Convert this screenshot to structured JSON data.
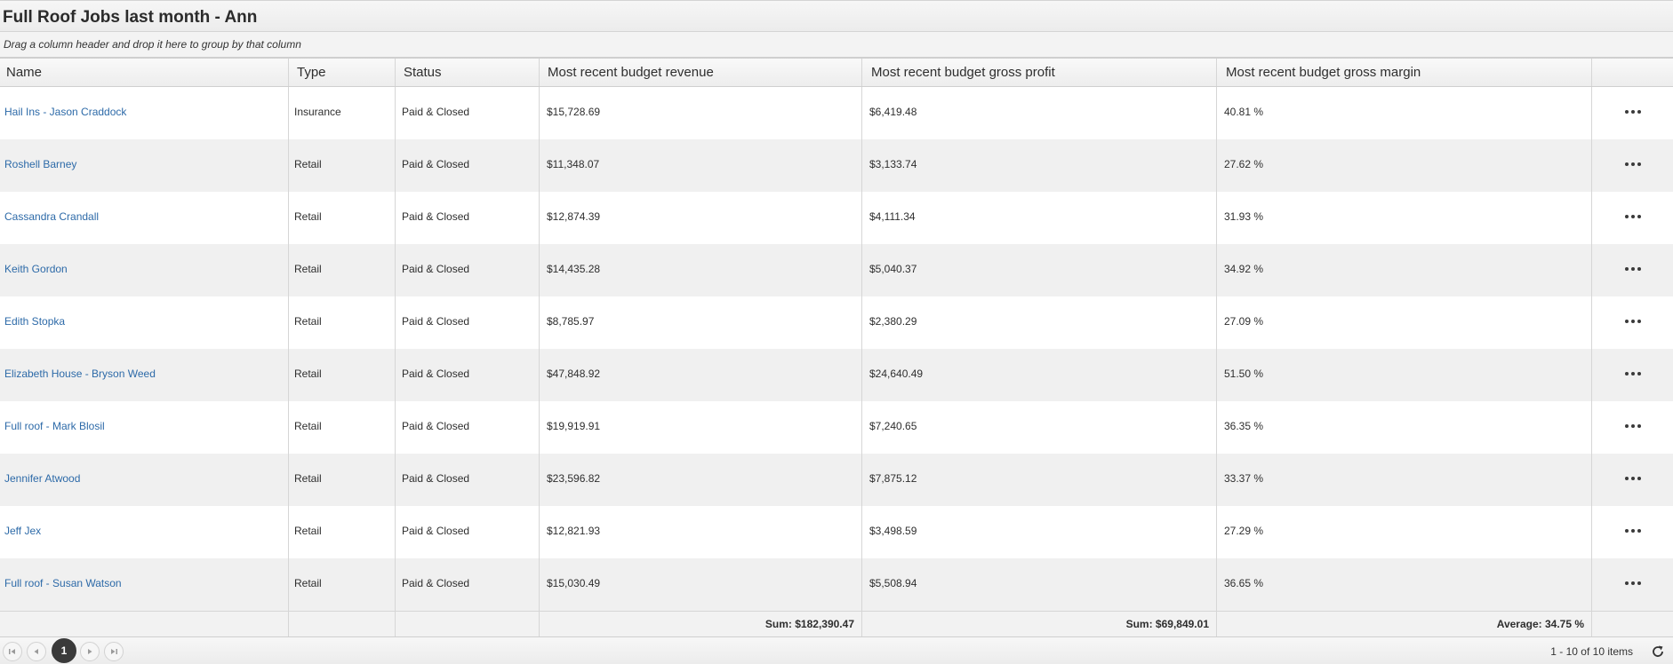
{
  "title": "Full Roof Jobs last month - Ann",
  "group_hint": "Drag a column header and drop it here to group by that column",
  "columns": [
    "Name",
    "Type",
    "Status",
    "Most recent budget revenue",
    "Most recent budget gross profit",
    "Most recent budget gross margin",
    ""
  ],
  "rows": [
    {
      "name": "Hail Ins - Jason Craddock",
      "type": "Insurance",
      "status": "Paid & Closed",
      "revenue": "$15,728.69",
      "profit": "$6,419.48",
      "margin": "40.81 %"
    },
    {
      "name": "Roshell Barney",
      "type": "Retail",
      "status": "Paid & Closed",
      "revenue": "$11,348.07",
      "profit": "$3,133.74",
      "margin": "27.62 %"
    },
    {
      "name": "Cassandra Crandall",
      "type": "Retail",
      "status": "Paid & Closed",
      "revenue": "$12,874.39",
      "profit": "$4,111.34",
      "margin": "31.93 %"
    },
    {
      "name": "Keith Gordon",
      "type": "Retail",
      "status": "Paid & Closed",
      "revenue": "$14,435.28",
      "profit": "$5,040.37",
      "margin": "34.92 %"
    },
    {
      "name": "Edith Stopka",
      "type": "Retail",
      "status": "Paid & Closed",
      "revenue": "$8,785.97",
      "profit": "$2,380.29",
      "margin": "27.09 %"
    },
    {
      "name": "Elizabeth House - Bryson Weed",
      "type": "Retail",
      "status": "Paid & Closed",
      "revenue": "$47,848.92",
      "profit": "$24,640.49",
      "margin": "51.50 %"
    },
    {
      "name": "Full roof - Mark Blosil",
      "type": "Retail",
      "status": "Paid & Closed",
      "revenue": "$19,919.91",
      "profit": "$7,240.65",
      "margin": "36.35 %"
    },
    {
      "name": "Jennifer Atwood",
      "type": "Retail",
      "status": "Paid & Closed",
      "revenue": "$23,596.82",
      "profit": "$7,875.12",
      "margin": "33.37 %"
    },
    {
      "name": "Jeff Jex",
      "type": "Retail",
      "status": "Paid & Closed",
      "revenue": "$12,821.93",
      "profit": "$3,498.59",
      "margin": "27.29 %"
    },
    {
      "name": "Full roof - Susan Watson",
      "type": "Retail",
      "status": "Paid & Closed",
      "revenue": "$15,030.49",
      "profit": "$5,508.94",
      "margin": "36.65 %"
    }
  ],
  "footer": {
    "revenue_sum": "Sum: $182,390.47",
    "profit_sum": "Sum: $69,849.01",
    "margin_avg": "Average: 34.75 %"
  },
  "pager": {
    "first_icon": "first-page-icon",
    "prev_icon": "prev-page-icon",
    "current_page": "1",
    "next_icon": "next-page-icon",
    "last_icon": "last-page-icon",
    "info": "1 - 10 of 10 items",
    "refresh_icon": "refresh-icon"
  },
  "row_menu_icon": "more-horizontal-icon",
  "colors": {
    "link": "#2d6aa8",
    "row_alt": "#f0f0f0",
    "pager_current": "#3a3a3a"
  }
}
